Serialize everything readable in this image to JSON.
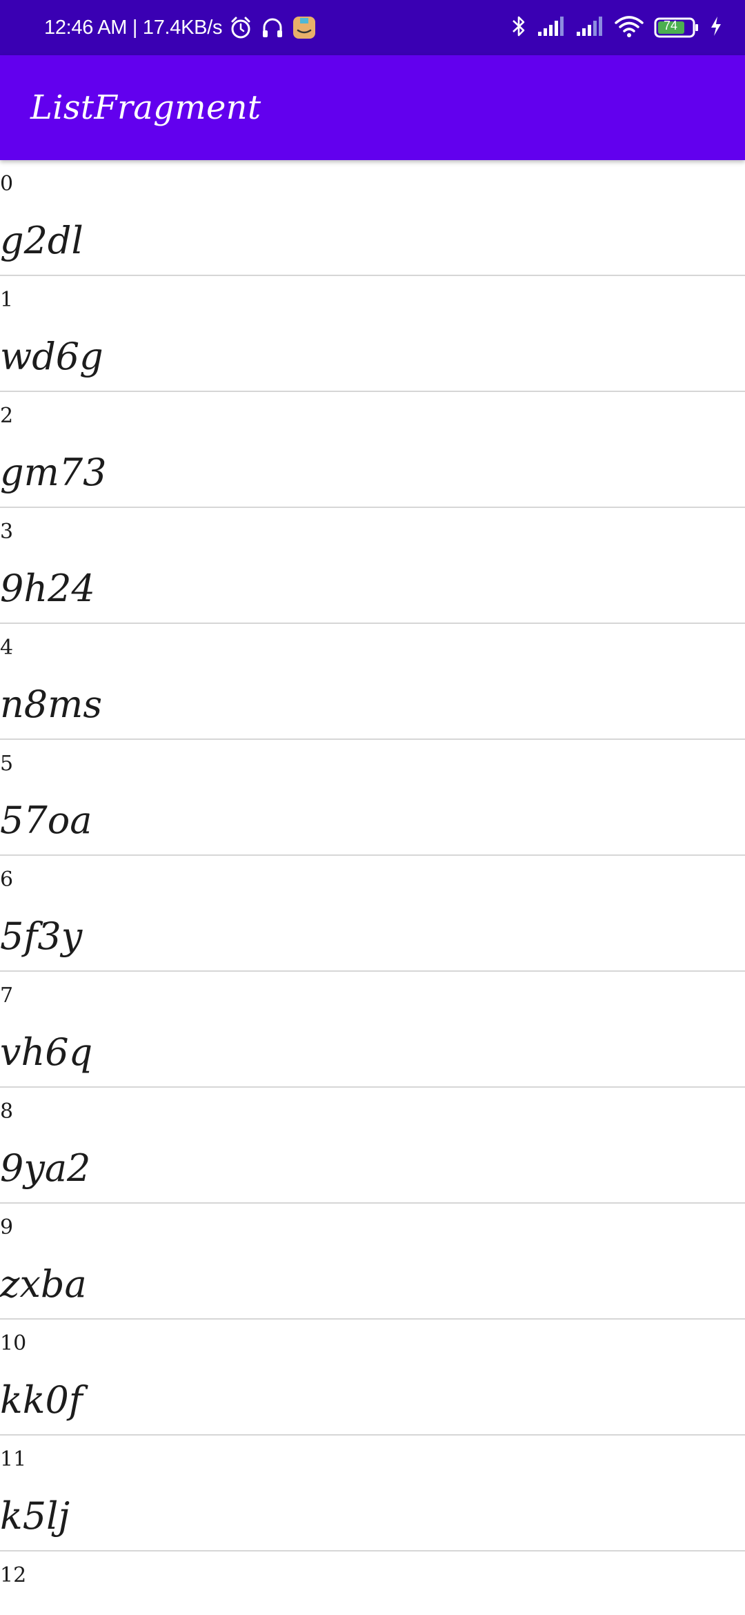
{
  "status_bar": {
    "time": "12:46 AM | 17.4KB/s",
    "battery_level": "74",
    "icons_left": [
      "alarm-icon",
      "headphones-icon",
      "package-app-icon"
    ],
    "icons_right": [
      "bluetooth-icon",
      "signal-strength-icon",
      "signal-strength-icon",
      "wifi-icon",
      "battery-icon",
      "charging-bolt-icon"
    ]
  },
  "app_bar": {
    "title": "ListFragment"
  },
  "list": {
    "items": [
      {
        "index": "0",
        "code": "g2dl"
      },
      {
        "index": "1",
        "code": "wd6g"
      },
      {
        "index": "2",
        "code": "gm73"
      },
      {
        "index": "3",
        "code": "9h24"
      },
      {
        "index": "4",
        "code": "n8ms"
      },
      {
        "index": "5",
        "code": "57oa"
      },
      {
        "index": "6",
        "code": "5f3y"
      },
      {
        "index": "7",
        "code": "vh6q"
      },
      {
        "index": "8",
        "code": "9ya2"
      },
      {
        "index": "9",
        "code": "zxba"
      },
      {
        "index": "10",
        "code": "kk0f"
      },
      {
        "index": "11",
        "code": "k5lj"
      },
      {
        "index": "12",
        "code": ""
      }
    ]
  },
  "colors": {
    "status_bar": "#3a00b3",
    "app_bar": "#6200ee",
    "divider": "#d6d6d6",
    "text": "#1c1c1c",
    "battery_fill": "#4caf50"
  }
}
